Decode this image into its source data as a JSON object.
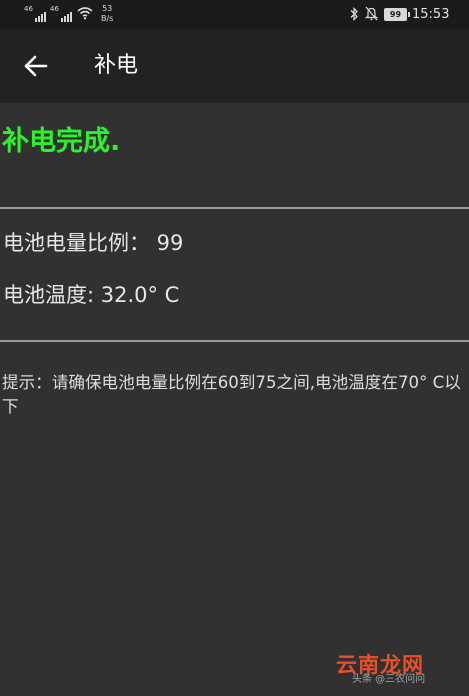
{
  "status_bar": {
    "sim1_tag": "46",
    "sim2_tag": "46",
    "net_speed_value": "53",
    "net_speed_unit": "B/s",
    "battery_level": "99",
    "time": "15:53"
  },
  "app_bar": {
    "back_icon": "arrow-left-icon",
    "title": "补电"
  },
  "main": {
    "status_message": "补电完成.",
    "battery_ratio_line": "电池电量比例： 99",
    "battery_temp_line": "电池温度: 32.0° C",
    "hint": "提示：请确保电池电量比例在60到75之间,电池温度在70° C以下"
  },
  "watermark": {
    "brand": "云南龙网",
    "sub": "头条 @三农问问"
  },
  "colors": {
    "background": "#313131",
    "app_bar": "#222222",
    "status_bar": "#1b1b1b",
    "success": "#2ef12e",
    "divider": "#9a9a9a",
    "watermark": "#e8502a"
  }
}
